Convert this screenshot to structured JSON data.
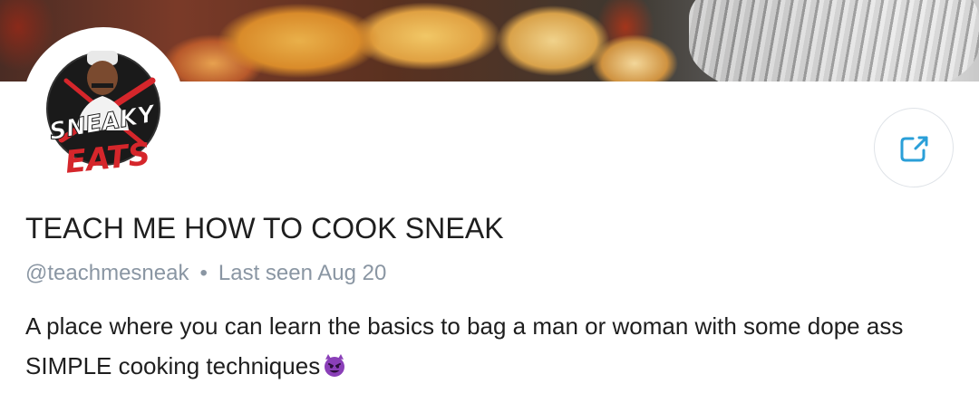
{
  "profile": {
    "display_name": "TEACH ME HOW TO COOK SNEAK",
    "handle": "@teachmesneak",
    "separator": "•",
    "last_seen": "Last seen Aug 20",
    "bio": "A place where you can learn the basics to bag a man or woman with some dope ass SIMPLE cooking techniques",
    "bio_emoji": "smiling-devil-emoji",
    "avatar_logo_text": "SNEAKY EATS"
  },
  "actions": {
    "share_icon": "share-icon"
  },
  "colors": {
    "accent": "#2a9fd8",
    "meta_text": "#8a96a3",
    "logo_red": "#d5262b",
    "emoji_purple": "#8a3fb8"
  }
}
